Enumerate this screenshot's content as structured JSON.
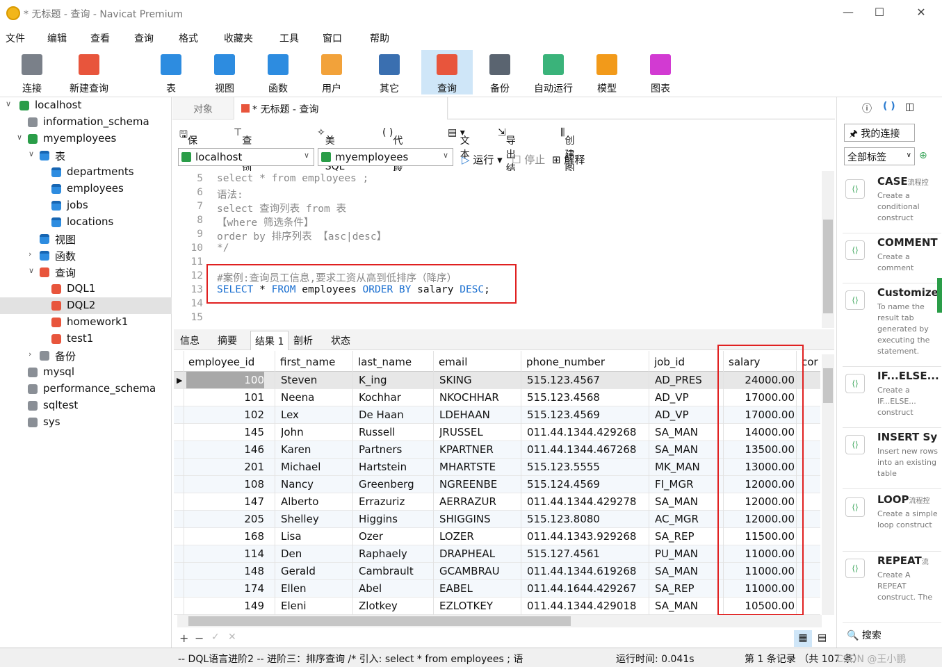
{
  "window": {
    "title": "* 无标题 - 查询 - Navicat Premium"
  },
  "menu": [
    "文件",
    "编辑",
    "查看",
    "查询",
    "格式",
    "收藏夹",
    "工具",
    "窗口",
    "帮助"
  ],
  "toolbar": [
    {
      "label": "连接",
      "color": "#7a8089"
    },
    {
      "label": "新建查询",
      "color": "#e8553c"
    },
    {
      "label": "表",
      "color": "#2d8ce0"
    },
    {
      "label": "视图",
      "color": "#2d8ce0"
    },
    {
      "label": "函数",
      "color": "#2d8ce0"
    },
    {
      "label": "用户",
      "color": "#f2a23a"
    },
    {
      "label": "其它",
      "color": "#3a6fb0"
    },
    {
      "label": "查询",
      "color": "#e8553c"
    },
    {
      "label": "备份",
      "color": "#5a6470"
    },
    {
      "label": "自动运行",
      "color": "#3ab37a"
    },
    {
      "label": "模型",
      "color": "#f29a1a"
    },
    {
      "label": "图表",
      "color": "#d23ad2"
    }
  ],
  "tree": [
    {
      "label": "localhost",
      "level": 0,
      "arrow": "∨",
      "type": "conn"
    },
    {
      "label": "information_schema",
      "level": 1,
      "arrow": "",
      "type": "db"
    },
    {
      "label": "myemployees",
      "level": 1,
      "arrow": "∨",
      "type": "dbg"
    },
    {
      "label": "表",
      "level": 2,
      "arrow": "∨",
      "type": "tbl"
    },
    {
      "label": "departments",
      "level": 3,
      "arrow": "",
      "type": "tbl"
    },
    {
      "label": "employees",
      "level": 3,
      "arrow": "",
      "type": "tbl"
    },
    {
      "label": "jobs",
      "level": 3,
      "arrow": "",
      "type": "tbl"
    },
    {
      "label": "locations",
      "level": 3,
      "arrow": "",
      "type": "tbl"
    },
    {
      "label": "视图",
      "level": 2,
      "arrow": "",
      "type": "tbl"
    },
    {
      "label": "函数",
      "level": 2,
      "arrow": "›",
      "type": "fx"
    },
    {
      "label": "查询",
      "level": 2,
      "arrow": "∨",
      "type": "q"
    },
    {
      "label": "DQL1",
      "level": 3,
      "arrow": "",
      "type": "q"
    },
    {
      "label": "DQL2",
      "level": 3,
      "arrow": "",
      "type": "q",
      "selected": true
    },
    {
      "label": "homework1",
      "level": 3,
      "arrow": "",
      "type": "q"
    },
    {
      "label": "test1",
      "level": 3,
      "arrow": "",
      "type": "q"
    },
    {
      "label": "备份",
      "level": 2,
      "arrow": "›",
      "type": "db"
    },
    {
      "label": "mysql",
      "level": 1,
      "arrow": "",
      "type": "db"
    },
    {
      "label": "performance_schema",
      "level": 1,
      "arrow": "",
      "type": "db"
    },
    {
      "label": "sqltest",
      "level": 1,
      "arrow": "",
      "type": "db"
    },
    {
      "label": "sys",
      "level": 1,
      "arrow": "",
      "type": "db"
    }
  ],
  "tabs": {
    "objects": "对象",
    "query": "* 无标题 - 查询"
  },
  "qtool": {
    "save": "保存",
    "builder": "查询创建工具",
    "beautify": "美化 SQL",
    "snippet": "代码段",
    "text": "文本",
    "export": "导出结果",
    "chart": "创建图表"
  },
  "selectors": {
    "connection": "localhost",
    "database": "myemployees",
    "run": "运行",
    "stop": "停止",
    "explain": "解释"
  },
  "editor": {
    "lines": [
      {
        "n": "5",
        "parts": [
          {
            "t": "select * from employees ;",
            "c": "cm"
          }
        ]
      },
      {
        "n": "6",
        "parts": [
          {
            "t": "语法:",
            "c": "cm"
          }
        ]
      },
      {
        "n": "7",
        "parts": [
          {
            "t": "select 查询列表 from 表",
            "c": "cm"
          }
        ]
      },
      {
        "n": "8",
        "parts": [
          {
            "t": "【where 筛选条件】",
            "c": "cm"
          }
        ]
      },
      {
        "n": "9",
        "parts": [
          {
            "t": "order by 排序列表 【asc|desc】",
            "c": "cm"
          }
        ]
      },
      {
        "n": "10",
        "parts": [
          {
            "t": "*/",
            "c": "cm"
          }
        ]
      },
      {
        "n": "11",
        "parts": []
      },
      {
        "n": "12",
        "parts": [
          {
            "t": "#案例:查询员工信息,要求工资从高到低排序（降序）",
            "c": "cm"
          }
        ]
      },
      {
        "n": "13",
        "parts": [
          {
            "t": "SELECT",
            "c": "kw"
          },
          {
            "t": " * ",
            "c": ""
          },
          {
            "t": "FROM",
            "c": "kw"
          },
          {
            "t": " employees ",
            "c": ""
          },
          {
            "t": "ORDER BY",
            "c": "kw"
          },
          {
            "t": " salary ",
            "c": ""
          },
          {
            "t": "DESC",
            "c": "kw"
          },
          {
            "t": ";",
            "c": ""
          }
        ]
      },
      {
        "n": "14",
        "parts": []
      },
      {
        "n": "15",
        "parts": []
      }
    ]
  },
  "result_tabs": [
    "信息",
    "摘要",
    "结果 1",
    "剖析",
    "状态"
  ],
  "grid": {
    "columns": [
      "employee_id",
      "first_name",
      "last_name",
      "email",
      "phone_number",
      "job_id",
      "salary",
      "cor"
    ],
    "rows": [
      [
        "100",
        "Steven",
        "K_ing",
        "SKING",
        "515.123.4567",
        "AD_PRES",
        "24000.00"
      ],
      [
        "101",
        "Neena",
        "Kochhar",
        "NKOCHHAR",
        "515.123.4568",
        "AD_VP",
        "17000.00"
      ],
      [
        "102",
        "Lex",
        "De Haan",
        "LDEHAAN",
        "515.123.4569",
        "AD_VP",
        "17000.00"
      ],
      [
        "145",
        "John",
        "Russell",
        "JRUSSEL",
        "011.44.1344.429268",
        "SA_MAN",
        "14000.00"
      ],
      [
        "146",
        "Karen",
        "Partners",
        "KPARTNER",
        "011.44.1344.467268",
        "SA_MAN",
        "13500.00"
      ],
      [
        "201",
        "Michael",
        "Hartstein",
        "MHARTSTE",
        "515.123.5555",
        "MK_MAN",
        "13000.00"
      ],
      [
        "108",
        "Nancy",
        "Greenberg",
        "NGREENBE",
        "515.124.4569",
        "FI_MGR",
        "12000.00"
      ],
      [
        "147",
        "Alberto",
        "Errazuriz",
        "AERRAZUR",
        "011.44.1344.429278",
        "SA_MAN",
        "12000.00"
      ],
      [
        "205",
        "Shelley",
        "Higgins",
        "SHIGGINS",
        "515.123.8080",
        "AC_MGR",
        "12000.00"
      ],
      [
        "168",
        "Lisa",
        "Ozer",
        "LOZER",
        "011.44.1343.929268",
        "SA_REP",
        "11500.00"
      ],
      [
        "114",
        "Den",
        "Raphaely",
        "DRAPHEAL",
        "515.127.4561",
        "PU_MAN",
        "11000.00"
      ],
      [
        "148",
        "Gerald",
        "Cambrault",
        "GCAMBRAU",
        "011.44.1344.619268",
        "SA_MAN",
        "11000.00"
      ],
      [
        "174",
        "Ellen",
        "Abel",
        "EABEL",
        "011.44.1644.429267",
        "SA_REP",
        "11000.00"
      ],
      [
        "149",
        "Eleni",
        "Zlotkey",
        "EZLOTKEY",
        "011.44.1344.429018",
        "SA_MAN",
        "10500.00"
      ]
    ]
  },
  "status": {
    "sql": "-- DQL语言进阶2 -- 进阶三：排序查询 /* 引入: select * from employees ; 语",
    "time": "运行时间: 0.041s",
    "records": "第 1 条记录 （共 107 条）",
    "watermark": "CSDN @王小鹏"
  },
  "rpanel": {
    "connection": "我的连接",
    "tags": "全部标签",
    "search": "搜索",
    "snippets": [
      {
        "title": "CASE",
        "tag": "流程控",
        "desc": "Create a conditional construct"
      },
      {
        "title": "COMMENT",
        "tag": "",
        "desc": "Create a comment"
      },
      {
        "title": "Customize",
        "tag": "",
        "desc": "To name the result tab generated by executing the statement."
      },
      {
        "title": "IF...ELSE...",
        "tag": "",
        "desc": "Create a IF...ELSE... construct"
      },
      {
        "title": "INSERT Sy",
        "tag": "",
        "desc": "Insert new rows into an existing table"
      },
      {
        "title": "LOOP",
        "tag": "流程控",
        "desc": "Create a simple loop construct"
      },
      {
        "title": "REPEAT",
        "tag": "流",
        "desc": "Create A REPEAT construct. The"
      }
    ]
  }
}
